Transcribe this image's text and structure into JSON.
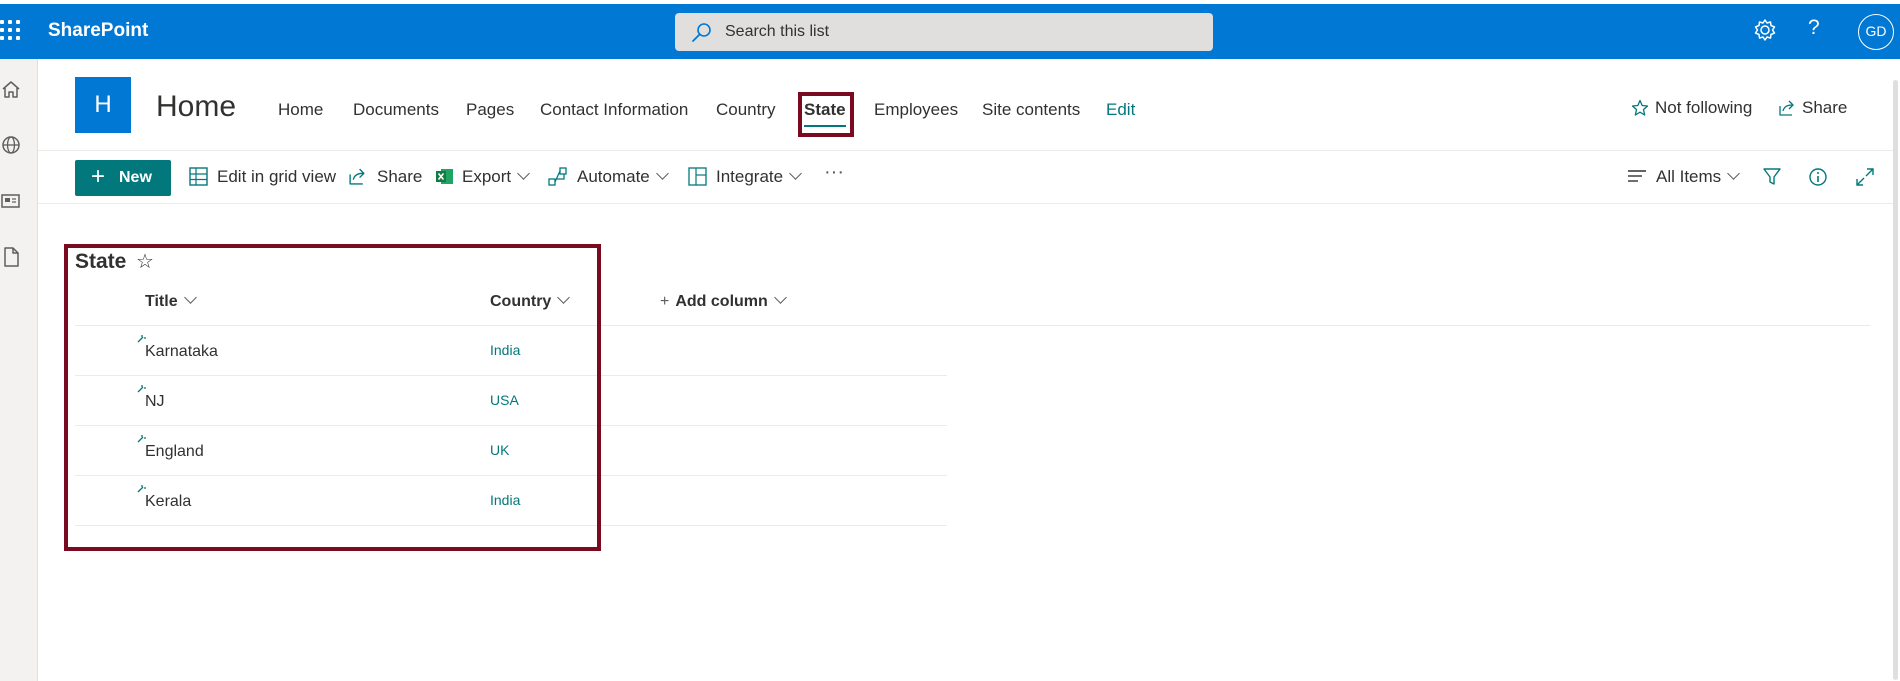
{
  "suite": {
    "brand": "SharePoint",
    "search_placeholder": "Search this list",
    "help": "?",
    "avatar_initials": "GD"
  },
  "site": {
    "logo_letter": "H",
    "title": "Home",
    "nav": [
      "Home",
      "Documents",
      "Pages",
      "Contact Information",
      "Country",
      "State",
      "Employees",
      "Site contents",
      "Edit"
    ],
    "active_nav": "State",
    "follow_label": "Not following",
    "share_label": "Share"
  },
  "commandbar": {
    "new": "New",
    "edit_grid": "Edit in grid view",
    "share": "Share",
    "export": "Export",
    "automate": "Automate",
    "integrate": "Integrate",
    "more": "···",
    "view": "All Items"
  },
  "list": {
    "title": "State",
    "columns": [
      "Title",
      "Country"
    ],
    "add_column": "Add column",
    "rows": [
      {
        "title": "Karnataka",
        "country": "India"
      },
      {
        "title": "NJ",
        "country": "USA"
      },
      {
        "title": "England",
        "country": "UK"
      },
      {
        "title": "Kerala",
        "country": "India"
      }
    ]
  },
  "colors": {
    "suitebar": "#0078d4",
    "accent": "#03787c",
    "highlight": "#7a0a1f"
  }
}
